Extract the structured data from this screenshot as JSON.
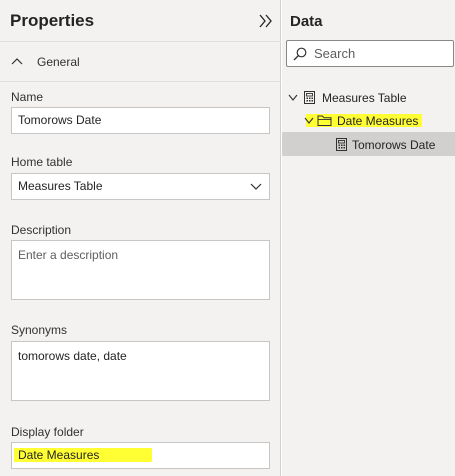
{
  "properties": {
    "title": "Properties",
    "section": "General",
    "name_label": "Name",
    "name_value": "Tomorows Date",
    "home_table_label": "Home table",
    "home_table_value": "Measures Table",
    "description_label": "Description",
    "description_placeholder": "Enter a description",
    "synonyms_label": "Synonyms",
    "synonyms_value": "tomorows date, date",
    "display_folder_label": "Display folder",
    "display_folder_value": "Date Measures"
  },
  "data_pane": {
    "title": "Data",
    "search_placeholder": "Search",
    "tree": [
      {
        "label": "Measures Table",
        "icon": "table-calculator-icon"
      },
      {
        "label": "Date Measures",
        "icon": "folder-icon"
      },
      {
        "label": "Tomorows Date",
        "icon": "calculator-icon"
      }
    ]
  },
  "colors": {
    "highlight": "#ffff33",
    "pane_bg": "#f3f2f1",
    "selected_row": "#d2d0ce"
  }
}
